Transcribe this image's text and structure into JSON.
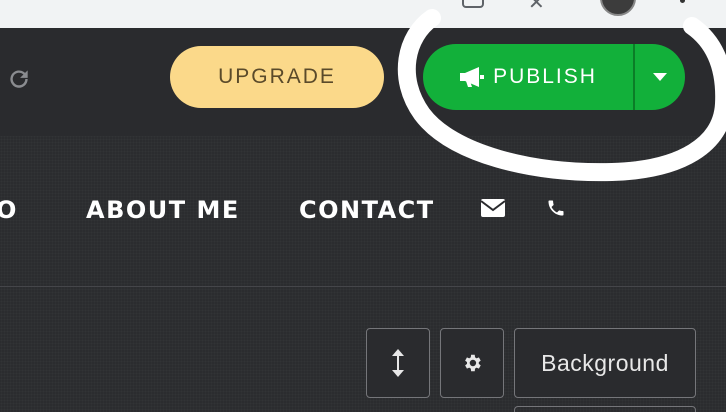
{
  "toolbar": {
    "upgrade_label": "UPGRADE",
    "publish_label": "PUBLISH",
    "colors": {
      "upgrade_bg": "#fbd98a",
      "publish_bg": "#12b03a"
    },
    "icons": [
      "reload-icon",
      "megaphone-icon",
      "caret-down-icon"
    ]
  },
  "nav": {
    "items": [
      {
        "label": "O"
      },
      {
        "label": "ABOUT ME"
      },
      {
        "label": "CONTACT"
      }
    ],
    "icons": [
      "envelope-icon",
      "phone-icon"
    ]
  },
  "section_controls": {
    "background_label": "Background",
    "icons": [
      "resize-vertical-icon",
      "gear-icon"
    ]
  }
}
